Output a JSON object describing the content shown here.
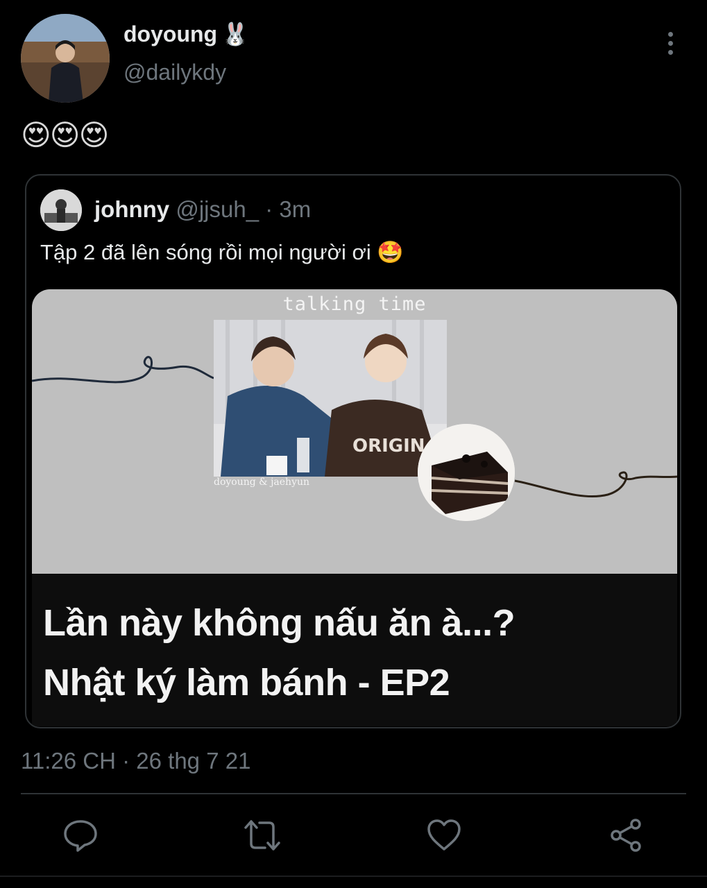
{
  "tweet": {
    "display_name": "doyoung",
    "name_emoji": "🐰",
    "handle": "@dailykdy",
    "text": "😍😍😍",
    "timestamp": "11:26 CH · 26 thg 7 21"
  },
  "quoted": {
    "display_name": "johnny",
    "handle_time": "@jjsuh_ · 3m",
    "text": "Tập 2 đã lên sóng rồi mọi người ơi",
    "text_emoji": "🤩",
    "media": {
      "caption_top": "talking time",
      "photo_caption": "doyoung & jaehyun",
      "title_line1": "Lần này không nấu ăn à...?",
      "title_line2": "Nhật ký làm bánh - EP2"
    }
  },
  "icons": [
    "more-vertical-icon",
    "reply-icon",
    "retweet-icon",
    "like-icon",
    "share-icon"
  ],
  "colors": {
    "background": "#000000",
    "muted": "#6e767d",
    "border": "#2f3336",
    "thumbnail": "#bfbfbf"
  }
}
